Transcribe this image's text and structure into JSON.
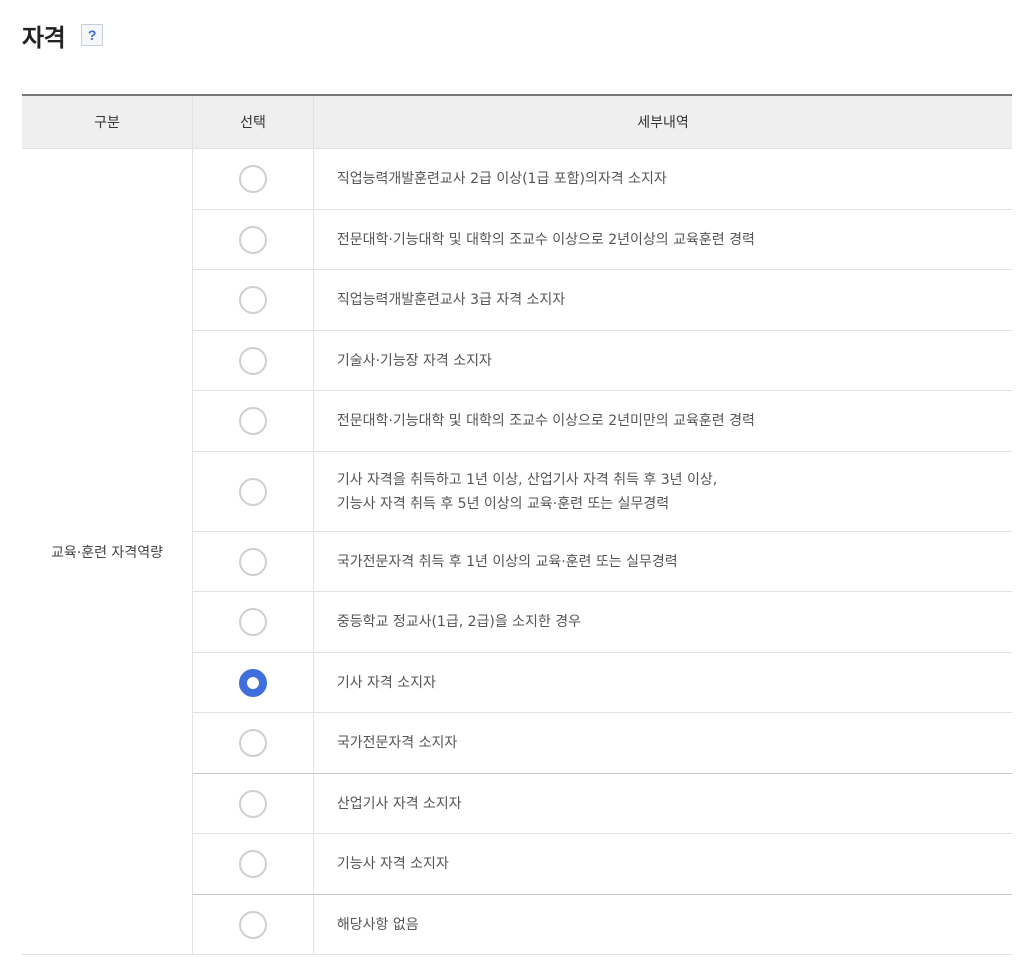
{
  "heading": {
    "title": "자격",
    "help_label": "?"
  },
  "table": {
    "headers": [
      "구분",
      "선택",
      "세부내역"
    ],
    "category": "교육·훈련 자격역량",
    "options": [
      {
        "lines": [
          "직업능력개발훈련교사 2급 이상(1급 포함)의자격 소지자"
        ],
        "selected": false
      },
      {
        "lines": [
          "전문대학·기능대학 및 대학의 조교수 이상으로 2년이상의 교육훈련 경력"
        ],
        "selected": false
      },
      {
        "lines": [
          "직업능력개발훈련교사 3급 자격 소지자"
        ],
        "selected": false
      },
      {
        "lines": [
          "기술사·기능장 자격 소지자"
        ],
        "selected": false
      },
      {
        "lines": [
          "전문대학·기능대학 및 대학의 조교수 이상으로 2년미만의 교육훈련 경력"
        ],
        "selected": false
      },
      {
        "lines": [
          "기사 자격을 취득하고 1년 이상, 산업기사 자격 취득 후 3년 이상,",
          "기능사 자격 취득 후 5년 이상의 교육·훈련 또는 실무경력"
        ],
        "selected": false
      },
      {
        "lines": [
          "국가전문자격 취득 후 1년 이상의 교육·훈련 또는 실무경력"
        ],
        "selected": false
      },
      {
        "lines": [
          "중등학교 정교사(1급, 2급)을 소지한 경우"
        ],
        "selected": false
      },
      {
        "lines": [
          "기사 자격 소지자"
        ],
        "selected": true
      },
      {
        "lines": [
          "국가전문자격 소지자"
        ],
        "selected": false
      },
      {
        "lines": [
          "산업기사 자격 소지자"
        ],
        "selected": false
      },
      {
        "lines": [
          "기능사 자격 소지자"
        ],
        "selected": false
      },
      {
        "lines": [
          "해당사항 없음"
        ],
        "selected": false
      }
    ]
  }
}
